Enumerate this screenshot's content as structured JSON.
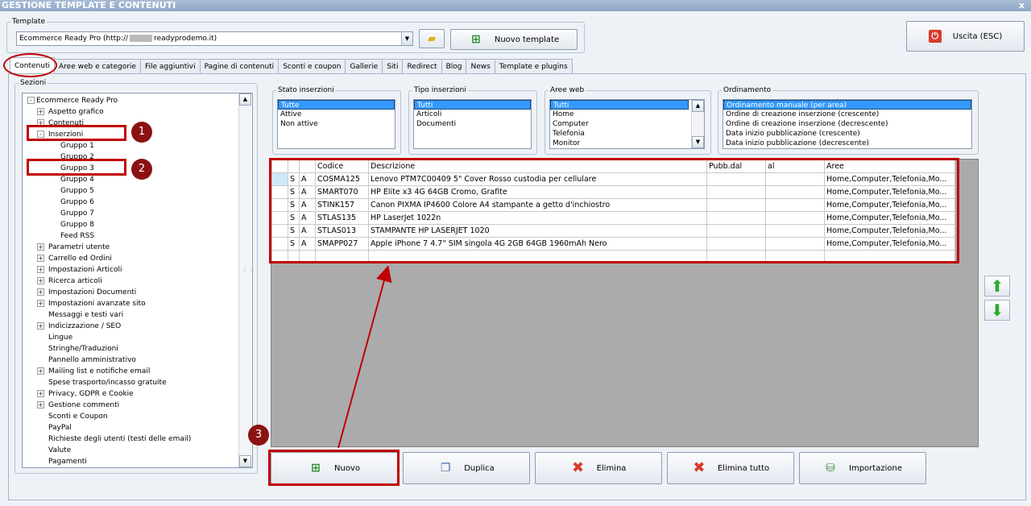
{
  "window": {
    "title": "GESTIONE TEMPLATE E CONTENUTI",
    "close_glyph": "x"
  },
  "template": {
    "label": "Template",
    "selected": "Ecommerce Ready Pro (http://",
    "selected_suffix": "readyprodemo.it)",
    "new_button": "Nuovo template",
    "exit_button": "Uscita (ESC)"
  },
  "tabs": [
    "Contenuti",
    "Aree web e categorie",
    "File aggiuntivi",
    "Pagine di contenuti",
    "Sconti e coupon",
    "Gallerie",
    "Siti",
    "Redirect",
    "Blog",
    "News",
    "Template e plugins"
  ],
  "sections": {
    "label": "Sezioni",
    "tree": [
      {
        "label": "Ecommerce Ready Pro",
        "level": 0,
        "expander": "-"
      },
      {
        "label": "Aspetto grafico",
        "level": 1,
        "expander": "+"
      },
      {
        "label": "Contenuti",
        "level": 1,
        "expander": "+"
      },
      {
        "label": "Inserzioni",
        "level": 1,
        "expander": "-"
      },
      {
        "label": "Gruppo 1",
        "level": 2,
        "expander": ""
      },
      {
        "label": "Gruppo 2",
        "level": 2,
        "expander": ""
      },
      {
        "label": "Gruppo 3",
        "level": 2,
        "expander": ""
      },
      {
        "label": "Gruppo 4",
        "level": 2,
        "expander": ""
      },
      {
        "label": "Gruppo 5",
        "level": 2,
        "expander": ""
      },
      {
        "label": "Gruppo 6",
        "level": 2,
        "expander": ""
      },
      {
        "label": "Gruppo 7",
        "level": 2,
        "expander": ""
      },
      {
        "label": "Gruppo 8",
        "level": 2,
        "expander": ""
      },
      {
        "label": "Feed RSS",
        "level": 2,
        "expander": ""
      },
      {
        "label": "Parametri utente",
        "level": 1,
        "expander": "+"
      },
      {
        "label": "Carrello ed Ordini",
        "level": 1,
        "expander": "+"
      },
      {
        "label": "Impostazioni Articoli",
        "level": 1,
        "expander": "+"
      },
      {
        "label": "Ricerca articoli",
        "level": 1,
        "expander": "+"
      },
      {
        "label": "Impostazioni Documenti",
        "level": 1,
        "expander": "+"
      },
      {
        "label": "Impostazioni avanzate sito",
        "level": 1,
        "expander": "+"
      },
      {
        "label": "Messaggi e testi vari",
        "level": 1,
        "expander": ""
      },
      {
        "label": "Indicizzazione / SEO",
        "level": 1,
        "expander": "+"
      },
      {
        "label": "Lingue",
        "level": 1,
        "expander": ""
      },
      {
        "label": "Stringhe/Traduzioni",
        "level": 1,
        "expander": ""
      },
      {
        "label": "Pannello amministrativo",
        "level": 1,
        "expander": ""
      },
      {
        "label": "Mailing list e notifiche email",
        "level": 1,
        "expander": "+"
      },
      {
        "label": "Spese trasporto/incasso gratuite",
        "level": 1,
        "expander": ""
      },
      {
        "label": "Privacy, GDPR e Cookie",
        "level": 1,
        "expander": "+"
      },
      {
        "label": "Gestione commenti",
        "level": 1,
        "expander": "+"
      },
      {
        "label": "Sconti e Coupon",
        "level": 1,
        "expander": ""
      },
      {
        "label": "PayPal",
        "level": 1,
        "expander": ""
      },
      {
        "label": "Richieste degli utenti (testi delle email)",
        "level": 1,
        "expander": ""
      },
      {
        "label": "Valute",
        "level": 1,
        "expander": ""
      },
      {
        "label": "Pagamenti",
        "level": 1,
        "expander": ""
      }
    ]
  },
  "filters": {
    "stato": {
      "label": "Stato inserzioni",
      "options": [
        "Tutte",
        "Attive",
        "Non attive"
      ],
      "selected": 0
    },
    "tipo": {
      "label": "Tipo inserzioni",
      "options": [
        "Tutti",
        "Articoli",
        "Documenti"
      ],
      "selected": 0
    },
    "aree": {
      "label": "Aree web",
      "options": [
        "Tutti",
        "Home",
        "Computer",
        "Telefonia",
        "Monitor"
      ],
      "selected": 0
    },
    "ordinamento": {
      "label": "Ordinamento",
      "options": [
        "Ordinamento manuale (per area)",
        "Ordine di creazione inserzione (crescente)",
        "Ordine di creazione inserzione (decrescente)",
        "Data inizio pubblicazione (crescente)",
        "Data inizio pubblicazione (decrescente)"
      ],
      "selected": 0
    }
  },
  "grid": {
    "headers": [
      "",
      "",
      "",
      "Codice",
      "Descrizione",
      "Pubb.dal",
      "al",
      "Aree"
    ],
    "rows": [
      [
        "",
        "S",
        "A",
        "COSMA125",
        "Lenovo PTM7C00409 5\" Cover Rosso custodia per cellulare",
        "",
        "",
        "Home,Computer,Telefonia,Mo..."
      ],
      [
        "",
        "S",
        "A",
        "SMART070",
        "HP Elite x3 4G 64GB Cromo, Grafite",
        "",
        "",
        "Home,Computer,Telefonia,Mo..."
      ],
      [
        "",
        "S",
        "A",
        "STINK157",
        "Canon PIXMA IP4600 Colore A4 stampante a getto d'inchiostro",
        "",
        "",
        "Home,Computer,Telefonia,Mo..."
      ],
      [
        "",
        "S",
        "A",
        "STLAS135",
        "HP LaserJet 1022n",
        "",
        "",
        "Home,Computer,Telefonia,Mo..."
      ],
      [
        "",
        "S",
        "A",
        "STLAS013",
        "STAMPANTE HP LASERJET 1020",
        "",
        "",
        "Home,Computer,Telefonia,Mo..."
      ],
      [
        "",
        "S",
        "A",
        "SMAPP027",
        "Apple iPhone 7 4.7\" SIM singola 4G 2GB 64GB 1960mAh Nero",
        "",
        "",
        "Home,Computer,Telefonia,Mo..."
      ],
      [
        "",
        "",
        "",
        "",
        "",
        "",
        "",
        ""
      ]
    ]
  },
  "actions": {
    "nuovo": "Nuovo",
    "duplica": "Duplica",
    "elimina": "Elimina",
    "elimina_tutto": "Elimina tutto",
    "importazione": "Importazione"
  },
  "annotations": {
    "b1": "1",
    "b2": "2",
    "b3": "3"
  },
  "colors": {
    "accent": "#3399ff",
    "annotation_red": "#c00000",
    "badge": "#8b1212"
  }
}
